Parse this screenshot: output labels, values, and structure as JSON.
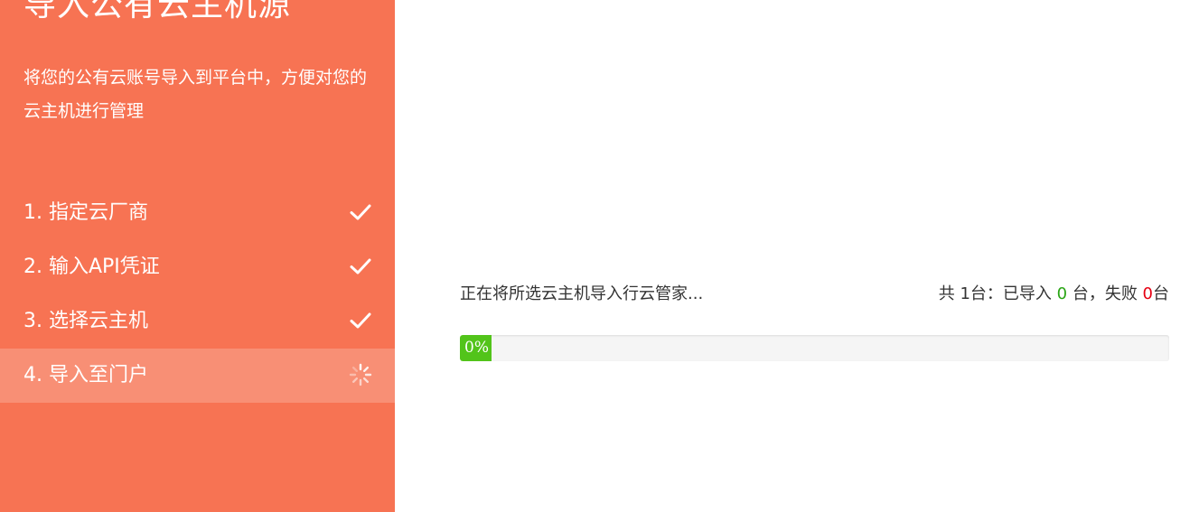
{
  "sidebar": {
    "title": "导入公有云主机源",
    "description": "将您的公有云账号导入到平台中，方便对您的云主机进行管理",
    "steps": [
      {
        "label": "1. 指定云厂商",
        "status": "done",
        "icon": "check-icon"
      },
      {
        "label": "2. 输入API凭证",
        "status": "done",
        "icon": "check-icon"
      },
      {
        "label": "3. 选择云主机",
        "status": "done",
        "icon": "check-icon"
      },
      {
        "label": "4. 导入至门户",
        "status": "in-progress",
        "icon": "spinner-icon"
      }
    ]
  },
  "main": {
    "status_text": "正在将所选云主机导入行云管家...",
    "stats": {
      "prefix": "共 1台：已导入 ",
      "imported": "0",
      "middle": " 台，失败 ",
      "failed": "0",
      "suffix": "台"
    },
    "progress": {
      "percent": 0,
      "label": "0%"
    }
  },
  "colors": {
    "sidebar_bg": "#f77353",
    "progress_fill": "#52c41a",
    "imported_count": "#2aa515",
    "failed_count": "#e60012"
  }
}
